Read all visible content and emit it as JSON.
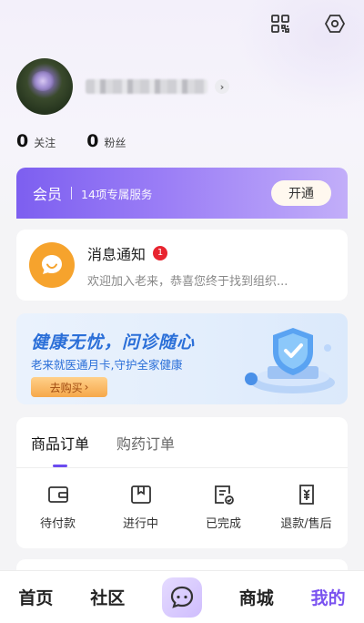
{
  "header": {
    "qr_icon": "qr-code-icon",
    "settings_icon": "hexagon-settings-icon"
  },
  "profile": {
    "chevron": "›"
  },
  "stats": [
    {
      "num": "0",
      "label": "关注"
    },
    {
      "num": "0",
      "label": "粉丝"
    }
  ],
  "member": {
    "title": "会员",
    "desc": "14项专属服务",
    "button": "开通"
  },
  "message": {
    "title": "消息通知",
    "badge": "1",
    "preview": "欢迎加入老来，恭喜您终于找到组织..."
  },
  "banner": {
    "title": "健康无忧，问诊随心",
    "subtitle": "老来就医通月卡,守护全家健康",
    "button": "去购买",
    "button_arrow": "›"
  },
  "orders": {
    "tabs": [
      "商品订单",
      "购药订单"
    ],
    "items": [
      {
        "label": "待付款",
        "icon": "wallet-icon"
      },
      {
        "label": "进行中",
        "icon": "package-icon"
      },
      {
        "label": "已完成",
        "icon": "completed-document-icon"
      },
      {
        "label": "退款/售后",
        "icon": "refund-icon"
      }
    ]
  },
  "tabbar": {
    "home": "首页",
    "community": "社区",
    "center_icon": "chat-bubble-icon",
    "mall": "商城",
    "mine": "我的"
  },
  "colors": {
    "accent": "#7a52f0",
    "member_gradient_start": "#7d5ff0",
    "badge_red": "#e8242f",
    "banner_blue": "#2b6fd8",
    "message_icon_orange": "#f6a32d"
  }
}
